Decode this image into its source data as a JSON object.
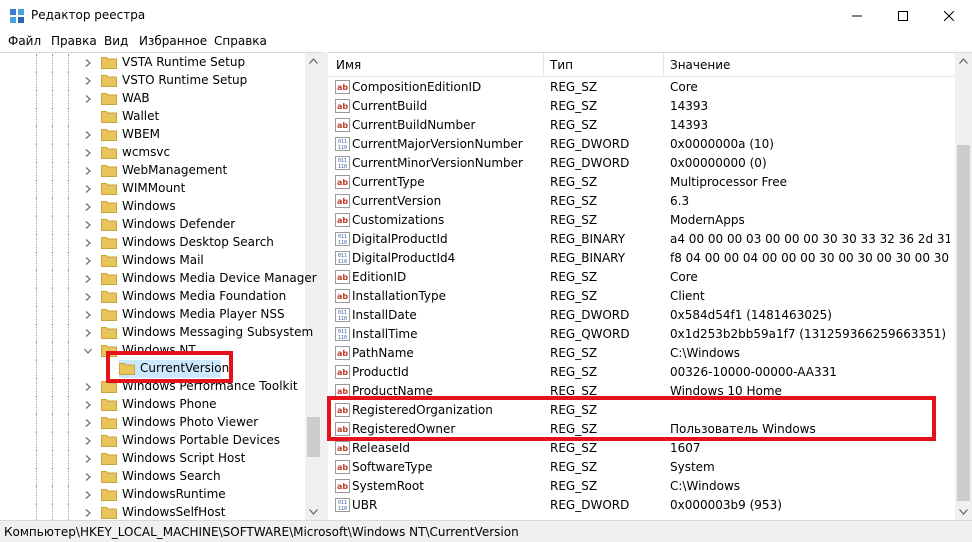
{
  "window": {
    "title": "Редактор реестра"
  },
  "menu": [
    "Файл",
    "Правка",
    "Вид",
    "Избранное",
    "Справка"
  ],
  "tree": [
    {
      "label": "VSTA Runtime Setup",
      "expanded": false
    },
    {
      "label": "VSTO Runtime Setup",
      "expanded": false
    },
    {
      "label": "WAB",
      "expanded": false
    },
    {
      "label": "Wallet",
      "expanded": null
    },
    {
      "label": "WBEM",
      "expanded": false
    },
    {
      "label": "wcmsvc",
      "expanded": false
    },
    {
      "label": "WebManagement",
      "expanded": false
    },
    {
      "label": "WIMMount",
      "expanded": false
    },
    {
      "label": "Windows",
      "expanded": false
    },
    {
      "label": "Windows Defender",
      "expanded": false
    },
    {
      "label": "Windows Desktop Search",
      "expanded": false
    },
    {
      "label": "Windows Mail",
      "expanded": false
    },
    {
      "label": "Windows Media Device Manager",
      "expanded": false
    },
    {
      "label": "Windows Media Foundation",
      "expanded": false
    },
    {
      "label": "Windows Media Player NSS",
      "expanded": false
    },
    {
      "label": "Windows Messaging Subsystem",
      "expanded": false
    },
    {
      "label": "Windows NT",
      "expanded": true
    },
    {
      "label": "CurrentVersion",
      "expanded": null,
      "selected": true,
      "child": true
    },
    {
      "label": "Windows Performance Toolkit",
      "expanded": false
    },
    {
      "label": "Windows Phone",
      "expanded": false
    },
    {
      "label": "Windows Photo Viewer",
      "expanded": false
    },
    {
      "label": "Windows Portable Devices",
      "expanded": false
    },
    {
      "label": "Windows Script Host",
      "expanded": false
    },
    {
      "label": "Windows Search",
      "expanded": false
    },
    {
      "label": "WindowsRuntime",
      "expanded": false
    },
    {
      "label": "WindowsSelfHost",
      "expanded": false
    }
  ],
  "columns": {
    "name": "Имя",
    "type": "Тип",
    "data": "Значение"
  },
  "values": [
    {
      "name": "CompositionEditionID",
      "type": "REG_SZ",
      "data": "Core",
      "icon": "string-value-icon"
    },
    {
      "name": "CurrentBuild",
      "type": "REG_SZ",
      "data": "14393",
      "icon": "string-value-icon"
    },
    {
      "name": "CurrentBuildNumber",
      "type": "REG_SZ",
      "data": "14393",
      "icon": "string-value-icon"
    },
    {
      "name": "CurrentMajorVersionNumber",
      "type": "REG_DWORD",
      "data": "0x0000000a (10)",
      "icon": "binary-value-icon"
    },
    {
      "name": "CurrentMinorVersionNumber",
      "type": "REG_DWORD",
      "data": "0x00000000 (0)",
      "icon": "binary-value-icon"
    },
    {
      "name": "CurrentType",
      "type": "REG_SZ",
      "data": "Multiprocessor Free",
      "icon": "string-value-icon"
    },
    {
      "name": "CurrentVersion",
      "type": "REG_SZ",
      "data": "6.3",
      "icon": "string-value-icon"
    },
    {
      "name": "Customizations",
      "type": "REG_SZ",
      "data": "ModernApps",
      "icon": "string-value-icon"
    },
    {
      "name": "DigitalProductId",
      "type": "REG_BINARY",
      "data": "a4 00 00 00 03 00 00 00 30 30 33 32 36 2d 31 30 30 3...",
      "icon": "binary-value-icon"
    },
    {
      "name": "DigitalProductId4",
      "type": "REG_BINARY",
      "data": "f8 04 00 00 04 00 00 00 30 00 30 00 30 00 30 00 30 00...",
      "icon": "binary-value-icon"
    },
    {
      "name": "EditionID",
      "type": "REG_SZ",
      "data": "Core",
      "icon": "string-value-icon"
    },
    {
      "name": "InstallationType",
      "type": "REG_SZ",
      "data": "Client",
      "icon": "string-value-icon"
    },
    {
      "name": "InstallDate",
      "type": "REG_DWORD",
      "data": "0x584d54f1 (1481463025)",
      "icon": "binary-value-icon"
    },
    {
      "name": "InstallTime",
      "type": "REG_QWORD",
      "data": "0x1d253b2bb59a1f7 (131259366259663351)",
      "icon": "binary-value-icon"
    },
    {
      "name": "PathName",
      "type": "REG_SZ",
      "data": "C:\\Windows",
      "icon": "string-value-icon"
    },
    {
      "name": "ProductId",
      "type": "REG_SZ",
      "data": "00326-10000-00000-AA331",
      "icon": "string-value-icon"
    },
    {
      "name": "ProductName",
      "type": "REG_SZ",
      "data": "Windows 10 Home",
      "icon": "string-value-icon"
    },
    {
      "name": "RegisteredOrganization",
      "type": "REG_SZ",
      "data": "",
      "icon": "string-value-icon"
    },
    {
      "name": "RegisteredOwner",
      "type": "REG_SZ",
      "data": "Пользователь Windows",
      "icon": "string-value-icon"
    },
    {
      "name": "ReleaseId",
      "type": "REG_SZ",
      "data": "1607",
      "icon": "string-value-icon"
    },
    {
      "name": "SoftwareType",
      "type": "REG_SZ",
      "data": "System",
      "icon": "string-value-icon"
    },
    {
      "name": "SystemRoot",
      "type": "REG_SZ",
      "data": "C:\\Windows",
      "icon": "string-value-icon"
    },
    {
      "name": "UBR",
      "type": "REG_DWORD",
      "data": "0x000003b9 (953)",
      "icon": "binary-value-icon"
    }
  ],
  "status": "Компьютер\\HKEY_LOCAL_MACHINE\\SOFTWARE\\Microsoft\\Windows NT\\CurrentVersion",
  "colors": {
    "highlight_border": "#e3121b",
    "selection_bg": "#cce8ff",
    "folder": "#e8c45a",
    "string_icon": "#c0392b",
    "binary_icon": "#2f5fa6"
  }
}
